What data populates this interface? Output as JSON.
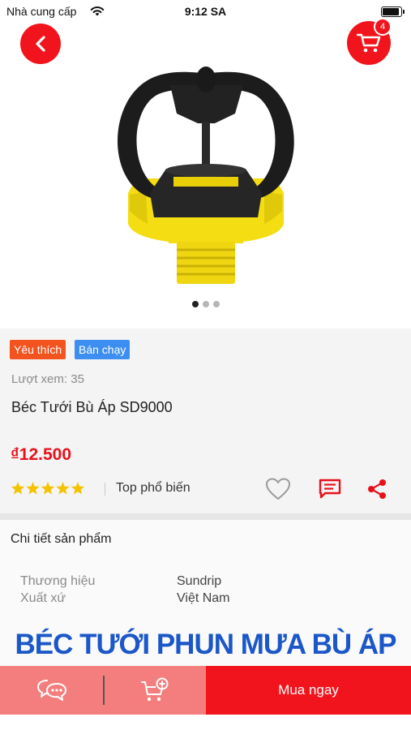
{
  "status_bar": {
    "carrier": "Nhà cung cấp",
    "time": "9:12 SA"
  },
  "header": {
    "back_icon": "chevron-left-icon",
    "cart_icon": "cart-icon",
    "cart_count": "4"
  },
  "gallery": {
    "image": "yellow-black-sprinkler-head",
    "slide_count": 3,
    "active_slide": 1
  },
  "product": {
    "tags": [
      "Yêu thích",
      "Bán chạy"
    ],
    "views": "Lượt xem: 35",
    "name": "Béc Tưới Bù Áp SD9000",
    "price": "₫12.500",
    "rating": 5,
    "popular_label": "Top phổ biến",
    "actions": [
      "heart-icon",
      "comment-icon",
      "share-icon"
    ]
  },
  "details": {
    "title": "Chi tiết sản phẩm",
    "specs": [
      {
        "key": "Thương hiệu",
        "value": "Sundrip"
      },
      {
        "key": "Xuất xứ",
        "value": "Việt Nam"
      }
    ],
    "banner": "BÉC TƯỚI PHUN MƯA BÙ ÁP"
  },
  "bottom_bar": {
    "chat_icon": "chat-icon",
    "add_cart_icon": "cart-plus-icon",
    "buy_label": "Mua ngay"
  },
  "colors": {
    "accent": "#f2141c",
    "price": "#e8111a",
    "fav_tag": "#f2531f",
    "hot_tag": "#3c8ef0",
    "banner": "#1b57c8",
    "star": "#f5c200",
    "bottom_left": "#f47e7e"
  }
}
